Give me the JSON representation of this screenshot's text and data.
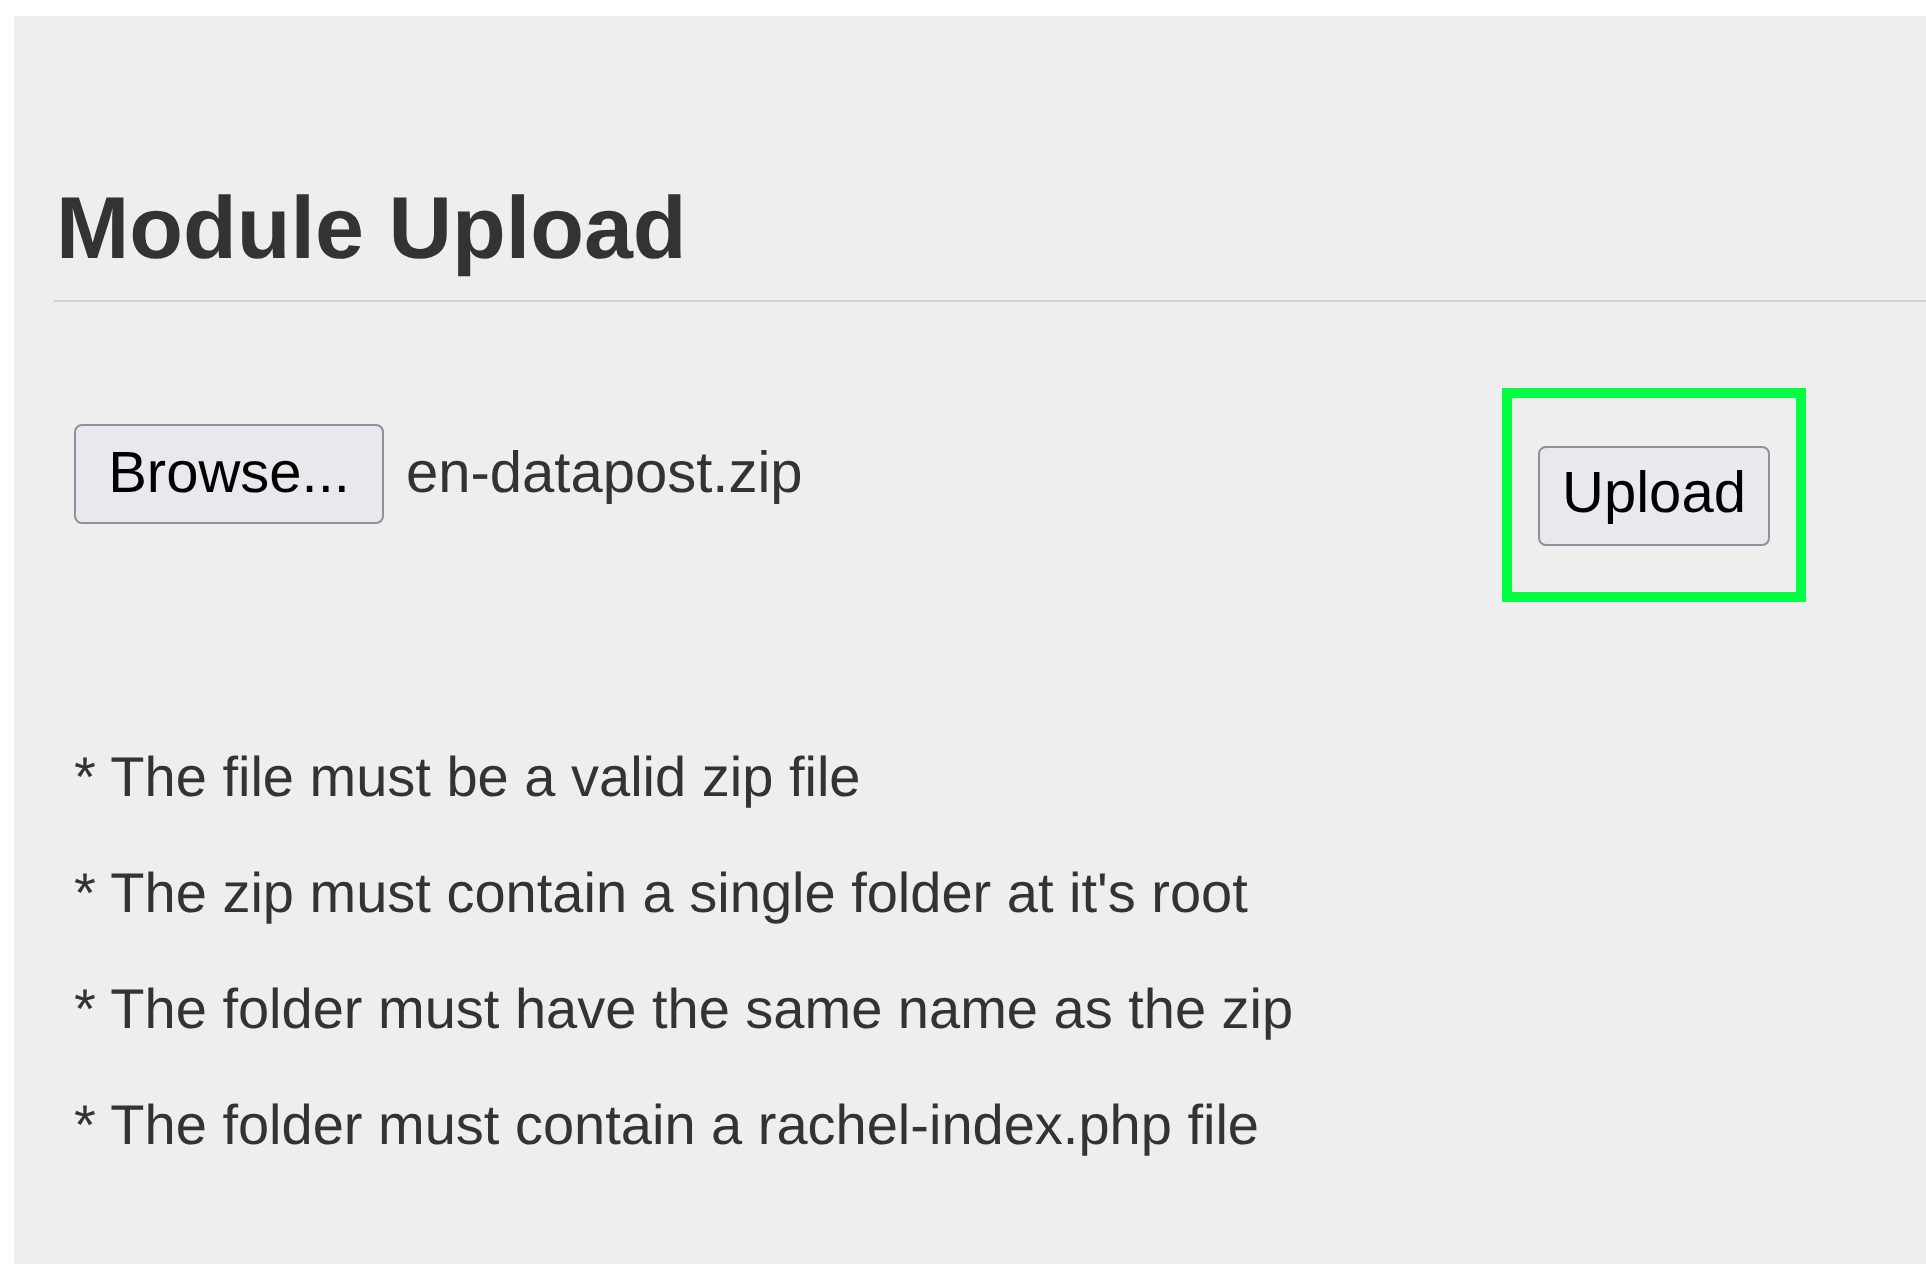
{
  "title": "Module Upload",
  "file_input": {
    "button": "Browse...",
    "filename": "en-datapost.zip"
  },
  "upload_button": {
    "label": "Upload",
    "highlighted": true
  },
  "requirements": [
    "* The file must be a valid zip file",
    "* The zip must contain a single folder at it's root",
    "* The folder must have the same name as the zip",
    "* The folder must contain a rachel-index.php file"
  ]
}
